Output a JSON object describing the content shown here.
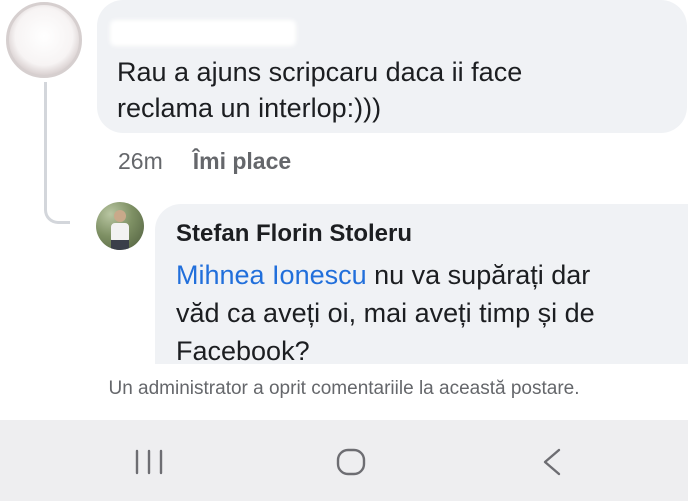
{
  "comment1": {
    "text_line1": "Rau a ajuns scripcaru daca ii face",
    "text_line2": "reclama un interlop:)))",
    "time": "26m",
    "like_label": "Îmi place"
  },
  "comment2": {
    "author": "Stefan Florin Stoleru",
    "mention": "Mihnea Ionescu",
    "text_after_mention": " nu va supărați dar",
    "text_line2": "văd ca aveți oi, mai aveți timp și de",
    "text_line3": "Facebook?"
  },
  "notice": "Un administrator a oprit comentariile la această postare.",
  "navbar": {
    "icons": [
      "recent-apps-icon",
      "home-icon",
      "back-icon"
    ]
  },
  "colors": {
    "bubble": "#f0f2f5",
    "mention": "#216fdb",
    "secondary_text": "#65676b",
    "navbar": "#eeeef0"
  }
}
